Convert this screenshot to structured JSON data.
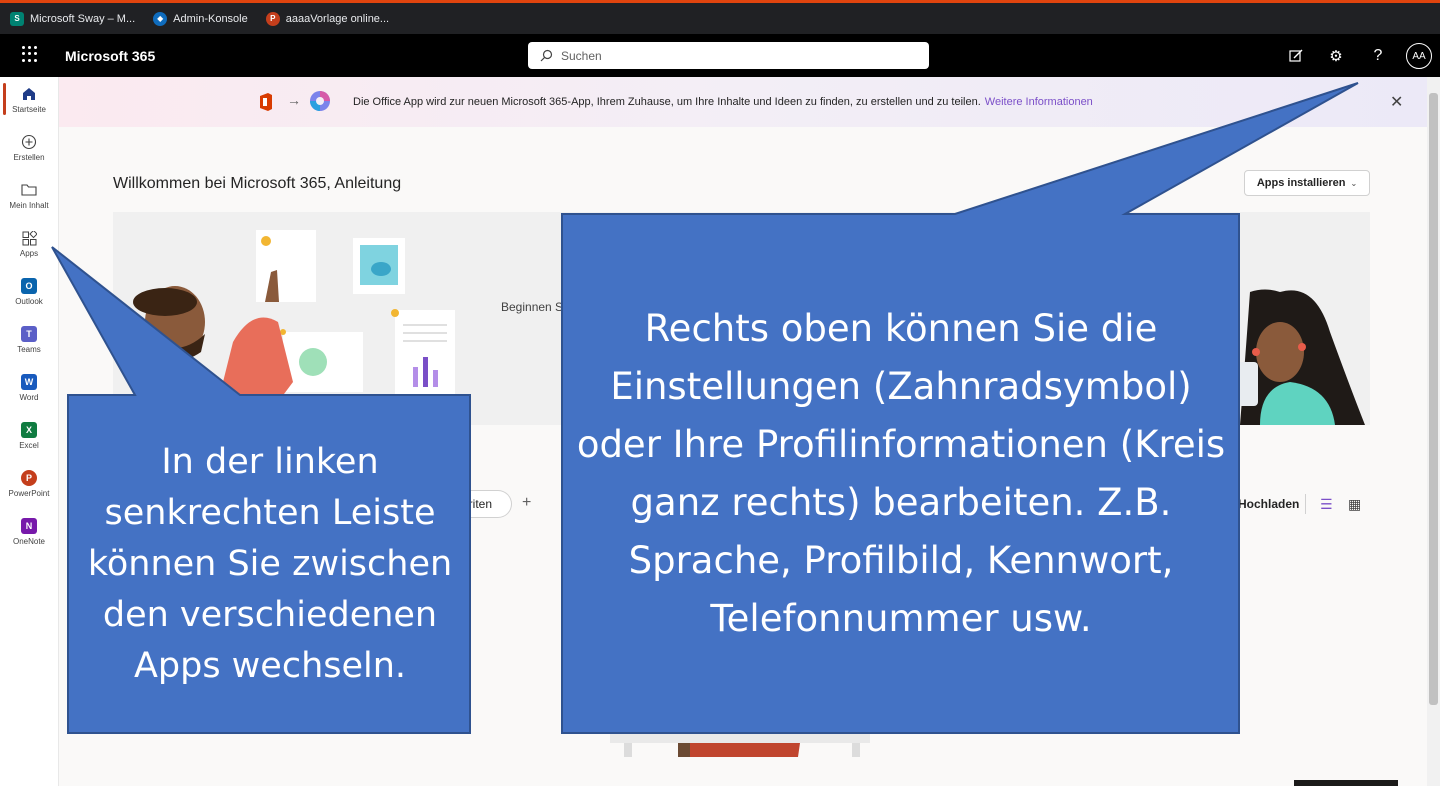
{
  "bookmarks": [
    {
      "icon": "sway-icon",
      "label": "Microsoft Sway – M..."
    },
    {
      "icon": "admin-icon",
      "label": "Admin-Konsole"
    },
    {
      "icon": "powerpoint-icon",
      "label": "aaaaVorlage online..."
    }
  ],
  "header": {
    "brand": "Microsoft 365",
    "search_placeholder": "Suchen",
    "help": "?",
    "avatar_initials": "AA"
  },
  "rail": {
    "items": [
      {
        "label": "Startseite",
        "icon": "home-icon"
      },
      {
        "label": "Erstellen",
        "icon": "add-circle-icon"
      },
      {
        "label": "Mein Inhalt",
        "icon": "folder-icon"
      },
      {
        "label": "Apps",
        "icon": "apps-grid-icon"
      },
      {
        "label": "Outlook",
        "icon": "outlook-icon",
        "letter": "O",
        "color": "#0a64ad"
      },
      {
        "label": "Teams",
        "icon": "teams-icon",
        "letter": "T",
        "color": "#5b5fc7"
      },
      {
        "label": "Word",
        "icon": "word-icon",
        "letter": "W",
        "color": "#185abd"
      },
      {
        "label": "Excel",
        "icon": "excel-icon",
        "letter": "X",
        "color": "#107c41"
      },
      {
        "label": "PowerPoint",
        "icon": "powerpoint-icon",
        "letter": "P",
        "color": "#c43e1c"
      },
      {
        "label": "OneNote",
        "icon": "onenote-icon",
        "letter": "N",
        "color": "#7719aa"
      }
    ]
  },
  "banner": {
    "text": "Die Office App wird zur neuen Microsoft 365-App, Ihrem Zuhause, um Ihre Inhalte und Ideen zu finden, zu erstellen und zu teilen.",
    "link": "Weitere Informationen"
  },
  "main": {
    "welcome": "Willkommen bei Microsoft 365, Anleitung",
    "install_button": "Apps installieren",
    "hero_text": "Beginnen S",
    "chip_label": "oriten",
    "upload_label": "Hochladen"
  },
  "callouts": {
    "left": "In der linken senkrechten Leiste können Sie zwischen den verschiedenen Apps wechseln.",
    "right": "Rechts oben können Sie die Einstellungen (Zahnradsymbol) oder Ihre Profilinformationen (Kreis ganz rechts) bearbeiten. Z.B. Sprache, Profilbild, Kennwort, Telefonnummer usw."
  },
  "colors": {
    "accent": "#7b4fc8",
    "callout_fill": "#4472c4",
    "callout_border": "#2f528f"
  }
}
